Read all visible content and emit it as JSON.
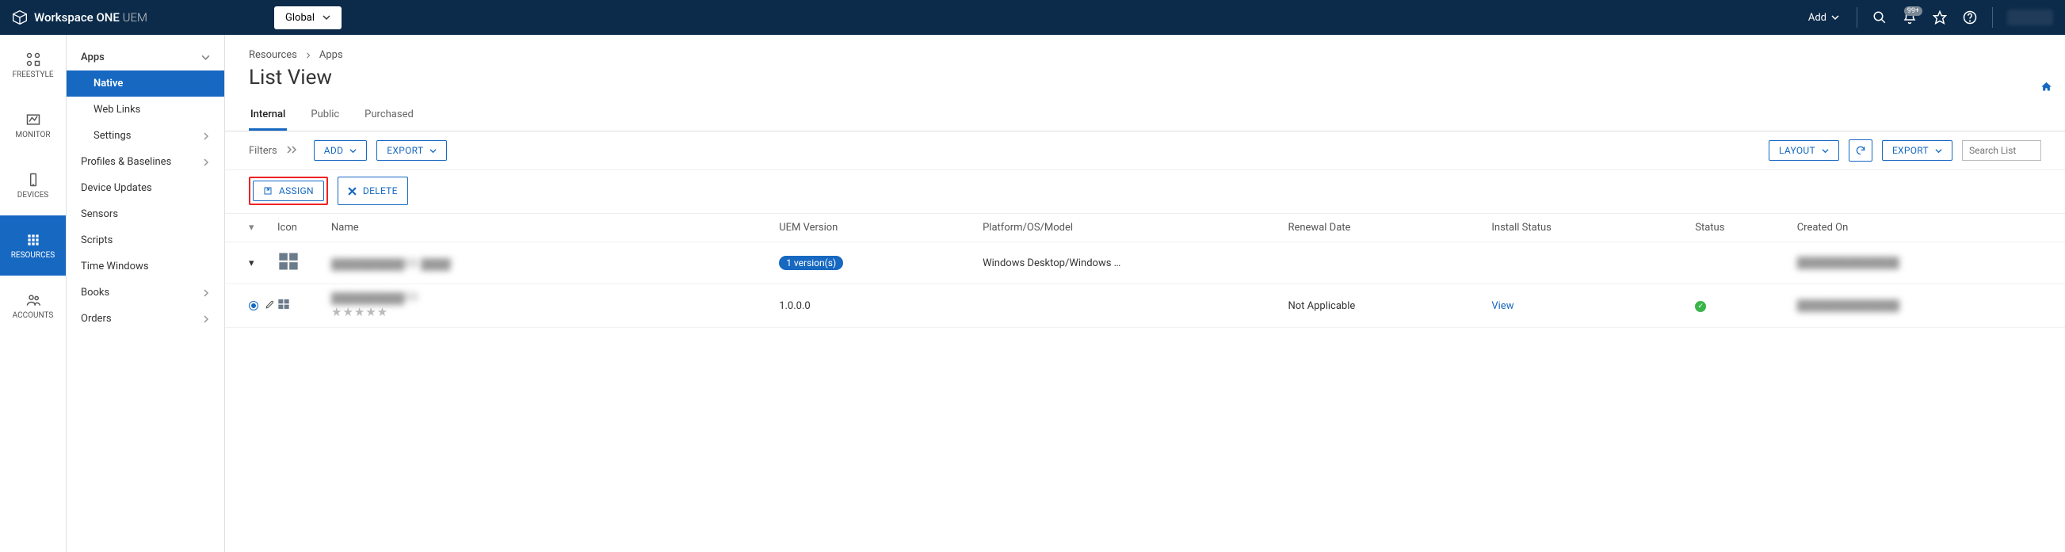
{
  "header": {
    "product": "Workspace ONE",
    "product_suffix": "UEM",
    "scope": "Global",
    "add_label": "Add",
    "notif_badge": "99+"
  },
  "rail": [
    {
      "key": "freestyle",
      "label": "FREESTYLE"
    },
    {
      "key": "monitor",
      "label": "MONITOR"
    },
    {
      "key": "devices",
      "label": "DEVICES"
    },
    {
      "key": "resources",
      "label": "RESOURCES"
    },
    {
      "key": "accounts",
      "label": "ACCOUNTS"
    }
  ],
  "sidebar": {
    "top": "Apps",
    "items": [
      {
        "label": "Native",
        "active": true,
        "child": true
      },
      {
        "label": "Web Links",
        "child": true
      },
      {
        "label": "Settings",
        "child": true,
        "chev": true
      },
      {
        "label": "Profiles & Baselines",
        "chev": true
      },
      {
        "label": "Device Updates"
      },
      {
        "label": "Sensors"
      },
      {
        "label": "Scripts"
      },
      {
        "label": "Time Windows"
      },
      {
        "label": "Books",
        "chev": true
      },
      {
        "label": "Orders",
        "chev": true
      }
    ]
  },
  "breadcrumb": {
    "a": "Resources",
    "b": "Apps"
  },
  "title": "List View",
  "tabs": [
    {
      "label": "Internal",
      "active": true
    },
    {
      "label": "Public"
    },
    {
      "label": "Purchased"
    }
  ],
  "filters_label": "Filters",
  "buttons": {
    "add": "ADD",
    "export": "EXPORT",
    "layout": "LAYOUT",
    "export2": "EXPORT",
    "assign": "ASSIGN",
    "delete": "DELETE"
  },
  "search_placeholder": "Search List",
  "columns": {
    "icon": "Icon",
    "name": "Name",
    "uem": "UEM Version",
    "platform": "Platform/OS/Model",
    "renewal": "Renewal Date",
    "install": "Install Status",
    "status": "Status",
    "created": "Created On"
  },
  "rows": {
    "parent": {
      "name_blur": "██████████",
      "sub_blur": "████",
      "ver_pill": "1 version(s)",
      "platform": "Windows Desktop/Windows …",
      "created_blur": "██████████████"
    },
    "child": {
      "name_blur": "██████████",
      "version": "1.0.0.0",
      "renewal": "Not Applicable",
      "install": "View",
      "created_blur": "██████████████"
    }
  }
}
